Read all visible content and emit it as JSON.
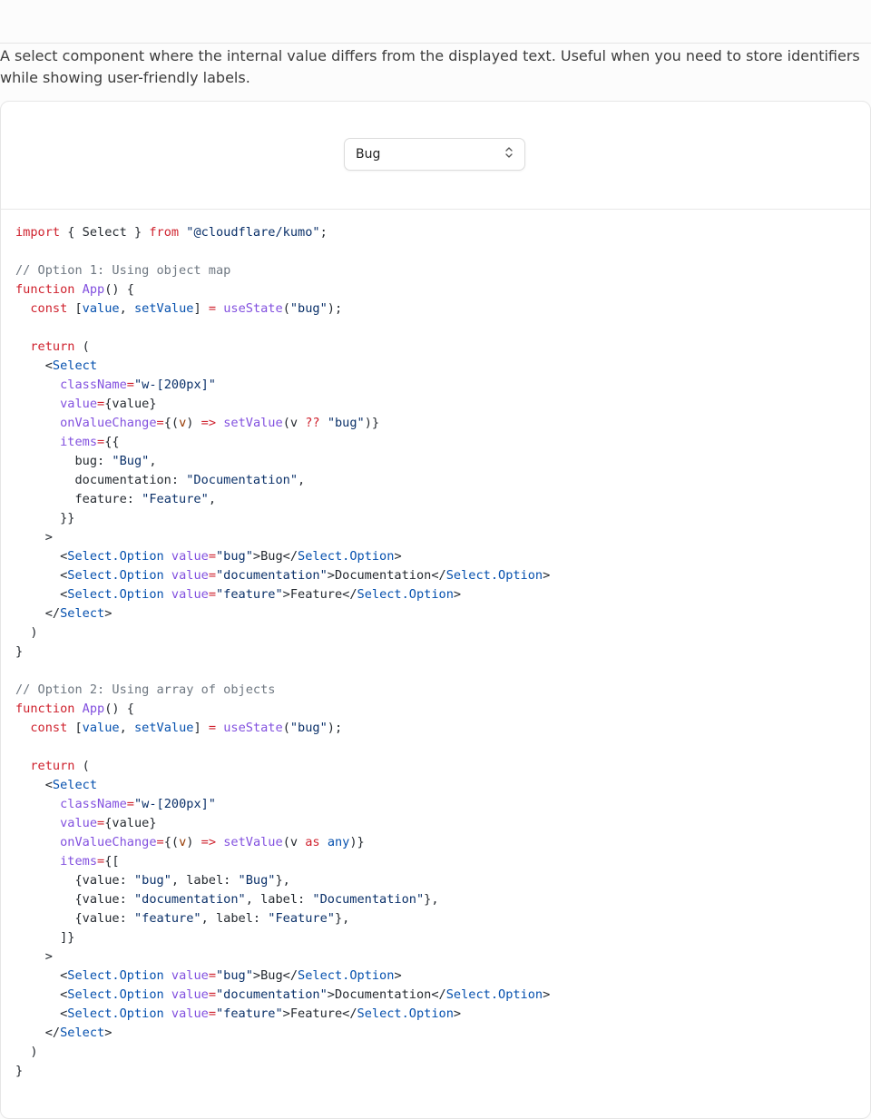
{
  "description": "A select component where the internal value differs from the displayed text. Useful when you need to store identifiers while showing user-friendly labels.",
  "preview": {
    "select_value": "Bug",
    "chevron_icon": "chevron-up-down-icon"
  },
  "code_lines": [
    [
      [
        "kw",
        "import"
      ],
      [
        "p",
        " { Select } "
      ],
      [
        "kw",
        "from"
      ],
      [
        "p",
        " "
      ],
      [
        "str",
        "\"@cloudflare/kumo\""
      ],
      [
        "p",
        ";"
      ]
    ],
    [],
    [
      [
        "com",
        "// Option 1: Using object map"
      ]
    ],
    [
      [
        "kw",
        "function"
      ],
      [
        "p",
        " "
      ],
      [
        "fn",
        "App"
      ],
      [
        "p",
        "() {"
      ]
    ],
    [
      [
        "p",
        "  "
      ],
      [
        "kw",
        "const"
      ],
      [
        "p",
        " ["
      ],
      [
        "attr",
        "value"
      ],
      [
        "p",
        ", "
      ],
      [
        "attr",
        "setValue"
      ],
      [
        "p",
        "] "
      ],
      [
        "kw",
        "="
      ],
      [
        "p",
        " "
      ],
      [
        "fn",
        "useState"
      ],
      [
        "p",
        "("
      ],
      [
        "str",
        "\"bug\""
      ],
      [
        "p",
        ");"
      ]
    ],
    [],
    [
      [
        "p",
        "  "
      ],
      [
        "kw",
        "return"
      ],
      [
        "p",
        " ("
      ]
    ],
    [
      [
        "p",
        "    <"
      ],
      [
        "attr",
        "Select"
      ]
    ],
    [
      [
        "p",
        "      "
      ],
      [
        "fn",
        "className"
      ],
      [
        "kw",
        "="
      ],
      [
        "str",
        "\"w-[200px]\""
      ]
    ],
    [
      [
        "p",
        "      "
      ],
      [
        "fn",
        "value"
      ],
      [
        "kw",
        "="
      ],
      [
        "p",
        "{value}"
      ]
    ],
    [
      [
        "p",
        "      "
      ],
      [
        "fn",
        "onValueChange"
      ],
      [
        "kw",
        "="
      ],
      [
        "p",
        "{("
      ],
      [
        "var",
        "v"
      ],
      [
        "p",
        ") "
      ],
      [
        "kw",
        "=>"
      ],
      [
        "p",
        " "
      ],
      [
        "fn",
        "setValue"
      ],
      [
        "p",
        "(v "
      ],
      [
        "kw",
        "??"
      ],
      [
        "p",
        " "
      ],
      [
        "str",
        "\"bug\""
      ],
      [
        "p",
        ")}"
      ]
    ],
    [
      [
        "p",
        "      "
      ],
      [
        "fn",
        "items"
      ],
      [
        "kw",
        "="
      ],
      [
        "p",
        "{{"
      ]
    ],
    [
      [
        "p",
        "        bug: "
      ],
      [
        "str",
        "\"Bug\""
      ],
      [
        "p",
        ","
      ]
    ],
    [
      [
        "p",
        "        documentation: "
      ],
      [
        "str",
        "\"Documentation\""
      ],
      [
        "p",
        ","
      ]
    ],
    [
      [
        "p",
        "        feature: "
      ],
      [
        "str",
        "\"Feature\""
      ],
      [
        "p",
        ","
      ]
    ],
    [
      [
        "p",
        "      }}"
      ]
    ],
    [
      [
        "p",
        "    >"
      ]
    ],
    [
      [
        "p",
        "      <"
      ],
      [
        "attr",
        "Select.Option"
      ],
      [
        "p",
        " "
      ],
      [
        "fn",
        "value"
      ],
      [
        "kw",
        "="
      ],
      [
        "str",
        "\"bug\""
      ],
      [
        "p",
        ">Bug</"
      ],
      [
        "attr",
        "Select.Option"
      ],
      [
        "p",
        ">"
      ]
    ],
    [
      [
        "p",
        "      <"
      ],
      [
        "attr",
        "Select.Option"
      ],
      [
        "p",
        " "
      ],
      [
        "fn",
        "value"
      ],
      [
        "kw",
        "="
      ],
      [
        "str",
        "\"documentation\""
      ],
      [
        "p",
        ">Documentation</"
      ],
      [
        "attr",
        "Select.Option"
      ],
      [
        "p",
        ">"
      ]
    ],
    [
      [
        "p",
        "      <"
      ],
      [
        "attr",
        "Select.Option"
      ],
      [
        "p",
        " "
      ],
      [
        "fn",
        "value"
      ],
      [
        "kw",
        "="
      ],
      [
        "str",
        "\"feature\""
      ],
      [
        "p",
        ">Feature</"
      ],
      [
        "attr",
        "Select.Option"
      ],
      [
        "p",
        ">"
      ]
    ],
    [
      [
        "p",
        "    </"
      ],
      [
        "attr",
        "Select"
      ],
      [
        "p",
        ">"
      ]
    ],
    [
      [
        "p",
        "  )"
      ]
    ],
    [
      [
        "p",
        "}"
      ]
    ],
    [],
    [
      [
        "com",
        "// Option 2: Using array of objects"
      ]
    ],
    [
      [
        "kw",
        "function"
      ],
      [
        "p",
        " "
      ],
      [
        "fn",
        "App"
      ],
      [
        "p",
        "() {"
      ]
    ],
    [
      [
        "p",
        "  "
      ],
      [
        "kw",
        "const"
      ],
      [
        "p",
        " ["
      ],
      [
        "attr",
        "value"
      ],
      [
        "p",
        ", "
      ],
      [
        "attr",
        "setValue"
      ],
      [
        "p",
        "] "
      ],
      [
        "kw",
        "="
      ],
      [
        "p",
        " "
      ],
      [
        "fn",
        "useState"
      ],
      [
        "p",
        "("
      ],
      [
        "str",
        "\"bug\""
      ],
      [
        "p",
        ");"
      ]
    ],
    [],
    [
      [
        "p",
        "  "
      ],
      [
        "kw",
        "return"
      ],
      [
        "p",
        " ("
      ]
    ],
    [
      [
        "p",
        "    <"
      ],
      [
        "attr",
        "Select"
      ]
    ],
    [
      [
        "p",
        "      "
      ],
      [
        "fn",
        "className"
      ],
      [
        "kw",
        "="
      ],
      [
        "str",
        "\"w-[200px]\""
      ]
    ],
    [
      [
        "p",
        "      "
      ],
      [
        "fn",
        "value"
      ],
      [
        "kw",
        "="
      ],
      [
        "p",
        "{value}"
      ]
    ],
    [
      [
        "p",
        "      "
      ],
      [
        "fn",
        "onValueChange"
      ],
      [
        "kw",
        "="
      ],
      [
        "p",
        "{("
      ],
      [
        "var",
        "v"
      ],
      [
        "p",
        ") "
      ],
      [
        "kw",
        "=>"
      ],
      [
        "p",
        " "
      ],
      [
        "fn",
        "setValue"
      ],
      [
        "p",
        "(v "
      ],
      [
        "kw",
        "as"
      ],
      [
        "p",
        " "
      ],
      [
        "attr",
        "any"
      ],
      [
        "p",
        ")}"
      ]
    ],
    [
      [
        "p",
        "      "
      ],
      [
        "fn",
        "items"
      ],
      [
        "kw",
        "="
      ],
      [
        "p",
        "{["
      ]
    ],
    [
      [
        "p",
        "        {value: "
      ],
      [
        "str",
        "\"bug\""
      ],
      [
        "p",
        ", label: "
      ],
      [
        "str",
        "\"Bug\""
      ],
      [
        "p",
        "},"
      ]
    ],
    [
      [
        "p",
        "        {value: "
      ],
      [
        "str",
        "\"documentation\""
      ],
      [
        "p",
        ", label: "
      ],
      [
        "str",
        "\"Documentation\""
      ],
      [
        "p",
        "},"
      ]
    ],
    [
      [
        "p",
        "        {value: "
      ],
      [
        "str",
        "\"feature\""
      ],
      [
        "p",
        ", label: "
      ],
      [
        "str",
        "\"Feature\""
      ],
      [
        "p",
        "},"
      ]
    ],
    [
      [
        "p",
        "      ]}"
      ]
    ],
    [
      [
        "p",
        "    >"
      ]
    ],
    [
      [
        "p",
        "      <"
      ],
      [
        "attr",
        "Select.Option"
      ],
      [
        "p",
        " "
      ],
      [
        "fn",
        "value"
      ],
      [
        "kw",
        "="
      ],
      [
        "str",
        "\"bug\""
      ],
      [
        "p",
        ">Bug</"
      ],
      [
        "attr",
        "Select.Option"
      ],
      [
        "p",
        ">"
      ]
    ],
    [
      [
        "p",
        "      <"
      ],
      [
        "attr",
        "Select.Option"
      ],
      [
        "p",
        " "
      ],
      [
        "fn",
        "value"
      ],
      [
        "kw",
        "="
      ],
      [
        "str",
        "\"documentation\""
      ],
      [
        "p",
        ">Documentation</"
      ],
      [
        "attr",
        "Select.Option"
      ],
      [
        "p",
        ">"
      ]
    ],
    [
      [
        "p",
        "      <"
      ],
      [
        "attr",
        "Select.Option"
      ],
      [
        "p",
        " "
      ],
      [
        "fn",
        "value"
      ],
      [
        "kw",
        "="
      ],
      [
        "str",
        "\"feature\""
      ],
      [
        "p",
        ">Feature</"
      ],
      [
        "attr",
        "Select.Option"
      ],
      [
        "p",
        ">"
      ]
    ],
    [
      [
        "p",
        "    </"
      ],
      [
        "attr",
        "Select"
      ],
      [
        "p",
        ">"
      ]
    ],
    [
      [
        "p",
        "  )"
      ]
    ],
    [
      [
        "p",
        "}"
      ]
    ]
  ]
}
